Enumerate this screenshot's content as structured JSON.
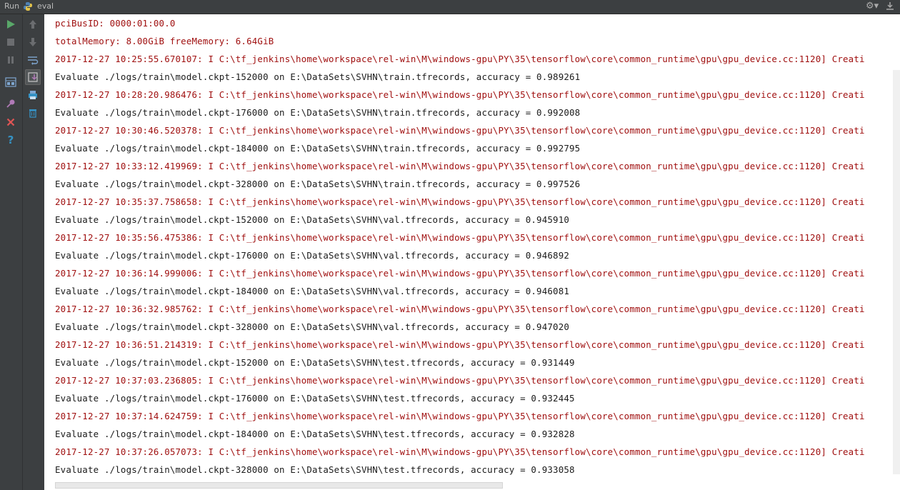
{
  "titlebar": {
    "run_label": "Run",
    "config_name": "eval"
  },
  "icons": {
    "python": "python-icon",
    "settings": "gear-icon",
    "hide": "hide-panel-icon"
  },
  "colors": {
    "stderr": "#a01010",
    "stdout": "#1a1a1a",
    "run_green": "#59a869",
    "close_red": "#e05555",
    "help_blue": "#3592c4"
  },
  "console": {
    "lines": [
      {
        "kind": "err",
        "text": "pciBusID: 0000:01:00.0"
      },
      {
        "kind": "err",
        "text": "totalMemory: 8.00GiB freeMemory: 6.64GiB"
      },
      {
        "kind": "err",
        "text": "2017-12-27 10:25:55.670107: I C:\\tf_jenkins\\home\\workspace\\rel-win\\M\\windows-gpu\\PY\\35\\tensorflow\\core\\common_runtime\\gpu\\gpu_device.cc:1120] Creati"
      },
      {
        "kind": "out",
        "text": "Evaluate ./logs/train\\model.ckpt-152000 on E:\\DataSets\\SVHN\\train.tfrecords, accuracy = 0.989261"
      },
      {
        "kind": "err",
        "text": "2017-12-27 10:28:20.986476: I C:\\tf_jenkins\\home\\workspace\\rel-win\\M\\windows-gpu\\PY\\35\\tensorflow\\core\\common_runtime\\gpu\\gpu_device.cc:1120] Creati"
      },
      {
        "kind": "out",
        "text": "Evaluate ./logs/train\\model.ckpt-176000 on E:\\DataSets\\SVHN\\train.tfrecords, accuracy = 0.992008"
      },
      {
        "kind": "err",
        "text": "2017-12-27 10:30:46.520378: I C:\\tf_jenkins\\home\\workspace\\rel-win\\M\\windows-gpu\\PY\\35\\tensorflow\\core\\common_runtime\\gpu\\gpu_device.cc:1120] Creati"
      },
      {
        "kind": "out",
        "text": "Evaluate ./logs/train\\model.ckpt-184000 on E:\\DataSets\\SVHN\\train.tfrecords, accuracy = 0.992795"
      },
      {
        "kind": "err",
        "text": "2017-12-27 10:33:12.419969: I C:\\tf_jenkins\\home\\workspace\\rel-win\\M\\windows-gpu\\PY\\35\\tensorflow\\core\\common_runtime\\gpu\\gpu_device.cc:1120] Creati"
      },
      {
        "kind": "out",
        "text": "Evaluate ./logs/train\\model.ckpt-328000 on E:\\DataSets\\SVHN\\train.tfrecords, accuracy = 0.997526"
      },
      {
        "kind": "err",
        "text": "2017-12-27 10:35:37.758658: I C:\\tf_jenkins\\home\\workspace\\rel-win\\M\\windows-gpu\\PY\\35\\tensorflow\\core\\common_runtime\\gpu\\gpu_device.cc:1120] Creati"
      },
      {
        "kind": "out",
        "text": "Evaluate ./logs/train\\model.ckpt-152000 on E:\\DataSets\\SVHN\\val.tfrecords, accuracy = 0.945910"
      },
      {
        "kind": "err",
        "text": "2017-12-27 10:35:56.475386: I C:\\tf_jenkins\\home\\workspace\\rel-win\\M\\windows-gpu\\PY\\35\\tensorflow\\core\\common_runtime\\gpu\\gpu_device.cc:1120] Creati"
      },
      {
        "kind": "out",
        "text": "Evaluate ./logs/train\\model.ckpt-176000 on E:\\DataSets\\SVHN\\val.tfrecords, accuracy = 0.946892"
      },
      {
        "kind": "err",
        "text": "2017-12-27 10:36:14.999006: I C:\\tf_jenkins\\home\\workspace\\rel-win\\M\\windows-gpu\\PY\\35\\tensorflow\\core\\common_runtime\\gpu\\gpu_device.cc:1120] Creati"
      },
      {
        "kind": "out",
        "text": "Evaluate ./logs/train\\model.ckpt-184000 on E:\\DataSets\\SVHN\\val.tfrecords, accuracy = 0.946081"
      },
      {
        "kind": "err",
        "text": "2017-12-27 10:36:32.985762: I C:\\tf_jenkins\\home\\workspace\\rel-win\\M\\windows-gpu\\PY\\35\\tensorflow\\core\\common_runtime\\gpu\\gpu_device.cc:1120] Creati"
      },
      {
        "kind": "out",
        "text": "Evaluate ./logs/train\\model.ckpt-328000 on E:\\DataSets\\SVHN\\val.tfrecords, accuracy = 0.947020"
      },
      {
        "kind": "err",
        "text": "2017-12-27 10:36:51.214319: I C:\\tf_jenkins\\home\\workspace\\rel-win\\M\\windows-gpu\\PY\\35\\tensorflow\\core\\common_runtime\\gpu\\gpu_device.cc:1120] Creati"
      },
      {
        "kind": "out",
        "text": "Evaluate ./logs/train\\model.ckpt-152000 on E:\\DataSets\\SVHN\\test.tfrecords, accuracy = 0.931449"
      },
      {
        "kind": "err",
        "text": "2017-12-27 10:37:03.236805: I C:\\tf_jenkins\\home\\workspace\\rel-win\\M\\windows-gpu\\PY\\35\\tensorflow\\core\\common_runtime\\gpu\\gpu_device.cc:1120] Creati"
      },
      {
        "kind": "out",
        "text": "Evaluate ./logs/train\\model.ckpt-176000 on E:\\DataSets\\SVHN\\test.tfrecords, accuracy = 0.932445"
      },
      {
        "kind": "err",
        "text": "2017-12-27 10:37:14.624759: I C:\\tf_jenkins\\home\\workspace\\rel-win\\M\\windows-gpu\\PY\\35\\tensorflow\\core\\common_runtime\\gpu\\gpu_device.cc:1120] Creati"
      },
      {
        "kind": "out",
        "text": "Evaluate ./logs/train\\model.ckpt-184000 on E:\\DataSets\\SVHN\\test.tfrecords, accuracy = 0.932828"
      },
      {
        "kind": "err",
        "text": "2017-12-27 10:37:26.057073: I C:\\tf_jenkins\\home\\workspace\\rel-win\\M\\windows-gpu\\PY\\35\\tensorflow\\core\\common_runtime\\gpu\\gpu_device.cc:1120] Creati"
      },
      {
        "kind": "out",
        "text": "Evaluate ./logs/train\\model.ckpt-328000 on E:\\DataSets\\SVHN\\test.tfrecords, accuracy = 0.933058"
      }
    ]
  }
}
